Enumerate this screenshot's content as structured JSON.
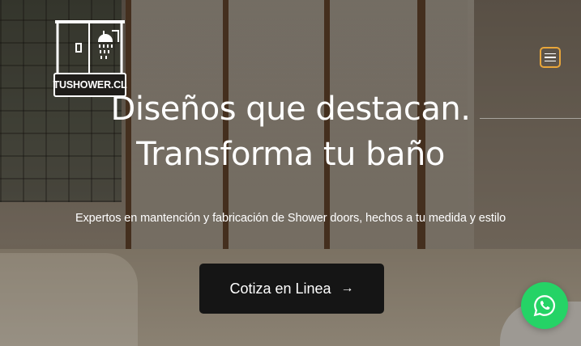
{
  "brand": {
    "logo_text": "TUSHOWER.CL"
  },
  "nav": {
    "menu_icon": "hamburger-menu-icon",
    "menu_border_color": "#e9a63a"
  },
  "hero": {
    "headline_line1": "Diseños que destacan.",
    "headline_line2": "Transforma tu baño",
    "subtitle": "Expertos en mantención y fabricación de Shower doors, hechos a tu medida y estilo",
    "cta_label": "Cotiza en Linea",
    "cta_icon": "arrow-right-icon",
    "background": "bathroom-shower-photo"
  },
  "whatsapp": {
    "icon": "whatsapp-icon",
    "color": "#25d366"
  }
}
